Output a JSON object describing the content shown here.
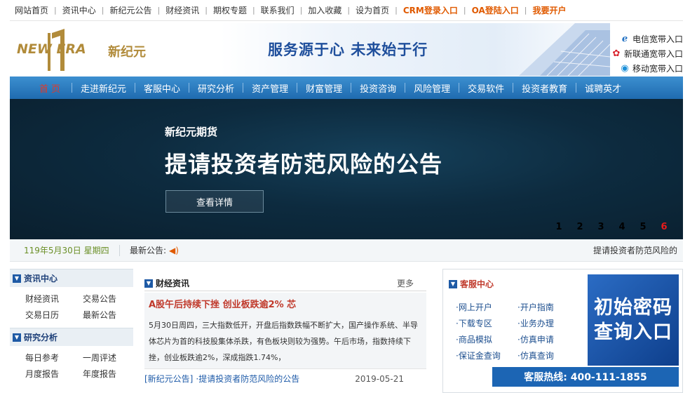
{
  "topbar": {
    "links": [
      "网站首页",
      "资讯中心",
      "新纪元公告",
      "财经资讯",
      "期权专题",
      "联系我们",
      "加入收藏",
      "设为首页"
    ],
    "highlight_links": [
      "CRM登录入口",
      "OA登陆入口",
      "我要开户"
    ],
    "accent": "#e05a00"
  },
  "header": {
    "logo_en": "NEW ERA",
    "logo_cn": "新纪元",
    "slogan": "服务源于心  未来始于行",
    "isp_links": [
      {
        "icon": "telecom-icon",
        "label": "电信宽带入口"
      },
      {
        "icon": "unicom-icon",
        "label": "新联通宽带入口"
      },
      {
        "icon": "mobile-icon",
        "label": "移动宽带入口"
      }
    ]
  },
  "nav": {
    "items": [
      "首页",
      "走进新纪元",
      "客服中心",
      "研究分析",
      "资产管理",
      "财富管理",
      "投资咨询",
      "风险管理",
      "交易软件",
      "投资者教育",
      "诚聘英才"
    ],
    "active_color": "#e03a2a"
  },
  "banner": {
    "subtitle": "新纪元期货",
    "title": "提请投资者防范风险的公告",
    "button": "查看详情",
    "pages": [
      "1",
      "2",
      "3",
      "4",
      "5",
      "6"
    ],
    "active_page": "6"
  },
  "strip": {
    "date": "119年5月30日 星期四",
    "news_label": "最新公告:",
    "marquee": "提请投资者防范风险的"
  },
  "left": {
    "sections": [
      {
        "title": "资讯中心",
        "items": [
          "财经资讯",
          "交易公告",
          "交易日历",
          "最新公告"
        ]
      },
      {
        "title": "研究分析",
        "items": [
          "每日参考",
          "一周评述",
          "月度报告",
          "年度报告"
        ]
      }
    ]
  },
  "middle": {
    "title": "财经资讯",
    "more": "更多",
    "feature_title": "A股午后持续下挫 创业板跌逾2% 芯",
    "feature_body": "5月30日周四，三大指数低开，开盘后指数跌幅不断扩大，国产操作系统、半导体芯片为首的科技股集体杀跌，有色板块则较为强势。午后市场，指数持续下挫，创业板跌逾2%，深成指跌1.74%，",
    "list": [
      {
        "tag": "[新纪元公告]",
        "title": "·提请投资者防范风险的公告",
        "date": "2019-05-21"
      }
    ]
  },
  "right": {
    "title": "客服中心",
    "items": [
      "·网上开户",
      "·开户指南",
      "·下载专区",
      "·业务办理",
      "·商品模拟",
      "·仿真申请",
      "·保证金查询",
      "·仿真查询"
    ],
    "query_line1": "初始密码",
    "query_line2": "查询入口",
    "hotline": "客服热线:  400-111-1855"
  }
}
